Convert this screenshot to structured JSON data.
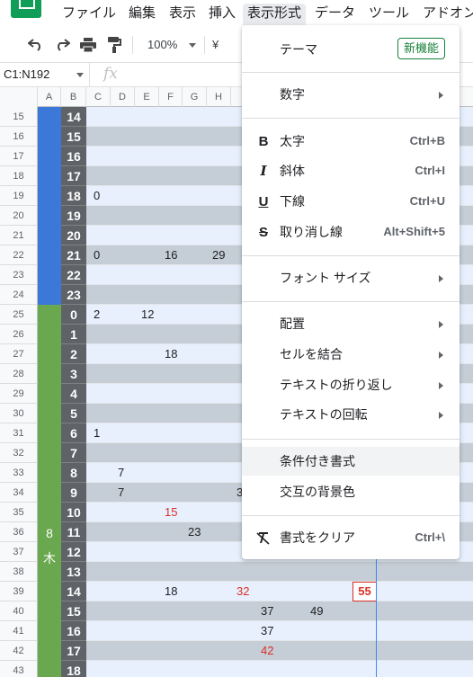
{
  "menubar": {
    "items": [
      {
        "label": "ファイル"
      },
      {
        "label": "編集"
      },
      {
        "label": "表示"
      },
      {
        "label": "挿入"
      },
      {
        "label": "表示形式"
      },
      {
        "label": "データ"
      },
      {
        "label": "ツール"
      },
      {
        "label": "アドオン"
      }
    ]
  },
  "toolbar": {
    "zoom": "100%",
    "currency": "¥"
  },
  "formula_bar": {
    "name_box": "C1:N192",
    "fx": "fx"
  },
  "grid": {
    "columns": [
      "A",
      "B",
      "C",
      "D",
      "E",
      "F",
      "G",
      "H"
    ],
    "rows": [
      {
        "num": "15",
        "b": "14"
      },
      {
        "num": "16",
        "b": "15"
      },
      {
        "num": "17",
        "b": "16"
      },
      {
        "num": "18",
        "b": "17"
      },
      {
        "num": "19",
        "b": "18",
        "c": "0"
      },
      {
        "num": "20",
        "b": "19"
      },
      {
        "num": "21",
        "b": "20"
      },
      {
        "num": "22",
        "b": "21",
        "c": "0",
        "f": "16",
        "h": "29"
      },
      {
        "num": "23",
        "b": "22"
      },
      {
        "num": "24",
        "b": "23"
      },
      {
        "num": "25",
        "b": "0",
        "c": "2",
        "e": "12"
      },
      {
        "num": "26",
        "b": "1"
      },
      {
        "num": "27",
        "b": "2",
        "f": "18"
      },
      {
        "num": "28",
        "b": "3"
      },
      {
        "num": "29",
        "b": "4"
      },
      {
        "num": "30",
        "b": "5"
      },
      {
        "num": "31",
        "b": "6",
        "c": "1"
      },
      {
        "num": "32",
        "b": "7"
      },
      {
        "num": "33",
        "b": "8",
        "d": "7"
      },
      {
        "num": "34",
        "b": "9",
        "d": "7",
        "i": "3"
      },
      {
        "num": "35",
        "b": "10",
        "f_red": "15"
      },
      {
        "num": "36",
        "b": "11",
        "g": "23"
      },
      {
        "num": "37",
        "b": "12"
      },
      {
        "num": "38",
        "b": "13"
      },
      {
        "num": "39",
        "b": "14",
        "f": "18",
        "i_red": "32",
        "box": "55"
      },
      {
        "num": "40",
        "b": "15",
        "j": "37",
        "k": "49"
      },
      {
        "num": "41",
        "b": "16",
        "j": "37"
      },
      {
        "num": "42",
        "b": "17",
        "j_red": "42"
      },
      {
        "num": "43",
        "b": "18"
      }
    ],
    "day_number": "8",
    "day_label": "木"
  },
  "format_menu": {
    "theme": {
      "label": "テーマ",
      "badge": "新機能"
    },
    "number": {
      "label": "数字"
    },
    "bold": {
      "label": "太字",
      "shortcut": "Ctrl+B"
    },
    "italic": {
      "label": "斜体",
      "shortcut": "Ctrl+I"
    },
    "underline": {
      "label": "下線",
      "shortcut": "Ctrl+U"
    },
    "strikethrough": {
      "label": "取り消し線",
      "shortcut": "Alt+Shift+5"
    },
    "font_size": {
      "label": "フォント サイズ"
    },
    "align": {
      "label": "配置"
    },
    "merge": {
      "label": "セルを結合"
    },
    "wrap": {
      "label": "テキストの折り返し"
    },
    "rotate": {
      "label": "テキストの回転"
    },
    "conditional": {
      "label": "条件付き書式"
    },
    "alternating": {
      "label": "交互の背景色"
    },
    "clear": {
      "label": "書式をクリア",
      "shortcut": "Ctrl+\\"
    }
  },
  "colors": {
    "accent_blue": "#3c78d8",
    "accent_green": "#6aa84f",
    "badge_green": "#188038",
    "red_text": "#d93025"
  }
}
